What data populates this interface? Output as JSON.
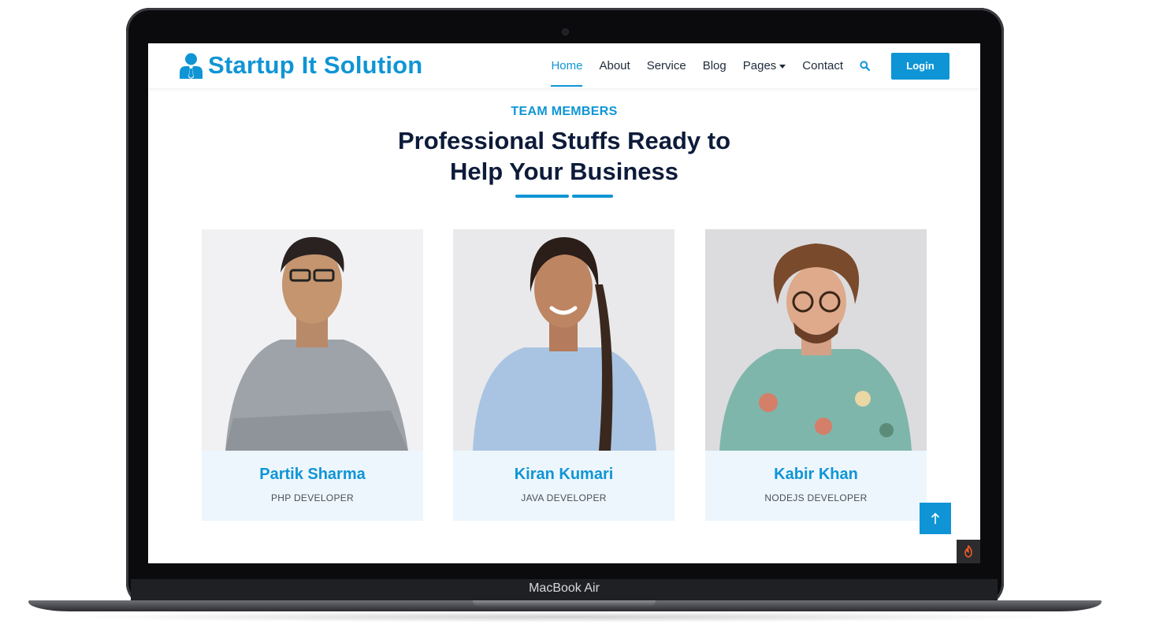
{
  "device": {
    "label": "MacBook Air"
  },
  "navbar": {
    "brand": "Startup It Solution",
    "items": [
      {
        "label": "Home",
        "active": true
      },
      {
        "label": "About"
      },
      {
        "label": "Service"
      },
      {
        "label": "Blog"
      },
      {
        "label": "Pages",
        "has_dropdown": true
      },
      {
        "label": "Contact"
      }
    ],
    "search_icon": "search-icon",
    "login_label": "Login"
  },
  "section": {
    "tag": "TEAM MEMBERS",
    "title_line1": "Professional Stuffs Ready to",
    "title_line2": "Help Your Business"
  },
  "team": [
    {
      "name": "Partik Sharma",
      "role": "PHP DEVELOPER"
    },
    {
      "name": "Kiran Kumari",
      "role": "JAVA DEVELOPER"
    },
    {
      "name": "Kabir Khan",
      "role": "NODEJS DEVELOPER"
    }
  ],
  "back_to_top_icon": "arrow-up-icon",
  "badge_icon": "flame-icon",
  "colors": {
    "accent": "#0f95d5",
    "heading": "#0d1b3a",
    "card_bg": "#edf6fd"
  }
}
